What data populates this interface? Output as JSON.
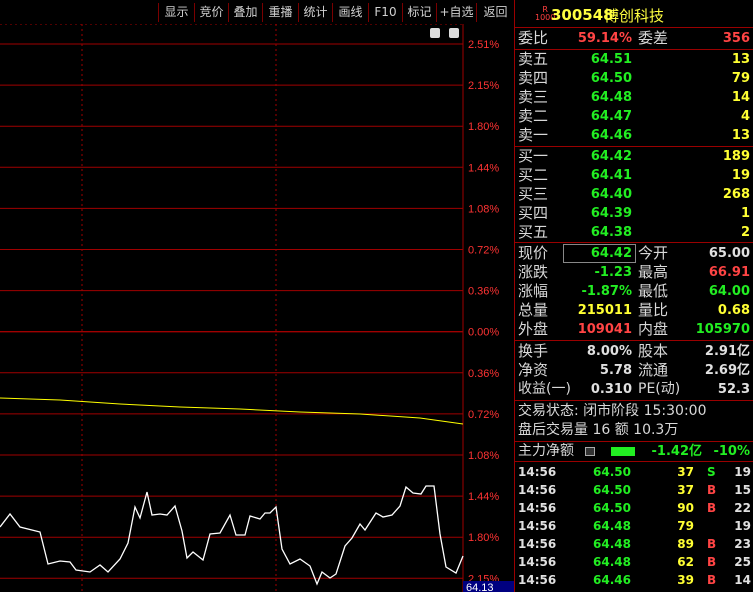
{
  "toolbar": {
    "buttons": [
      "显示",
      "竞价",
      "叠加",
      "重播",
      "统计",
      "画线",
      "F10",
      "标记",
      "+自选",
      "返回"
    ]
  },
  "chart_data": {
    "type": "line",
    "right_axis_labels": [
      "2.51%",
      "2.15%",
      "1.80%",
      "1.44%",
      "1.08%",
      "0.72%",
      "0.36%",
      "0.00%",
      "0.36%",
      "0.72%",
      "1.08%",
      "1.44%",
      "1.80%",
      "2.15%"
    ],
    "current_price_tag": "64.13",
    "colors": {
      "grid": "#a00000",
      "price_line": "#ffffff",
      "avg_line": "#ffff00",
      "label": "#ff3333",
      "tag_bg": "#000080"
    }
  },
  "stock": {
    "r_badge": "R",
    "r_sub": "1000",
    "code": "300548",
    "name": "博创科技"
  },
  "bid_ratio": {
    "label": "委比",
    "value": "59.14%",
    "diff_label": "委差",
    "diff_value": "356"
  },
  "sells": [
    {
      "label": "卖五",
      "price": "64.51",
      "volume": "13"
    },
    {
      "label": "卖四",
      "price": "64.50",
      "volume": "79"
    },
    {
      "label": "卖三",
      "price": "64.48",
      "volume": "14"
    },
    {
      "label": "卖二",
      "price": "64.47",
      "volume": "4"
    },
    {
      "label": "卖一",
      "price": "64.46",
      "volume": "13"
    }
  ],
  "buys": [
    {
      "label": "买一",
      "price": "64.42",
      "volume": "189"
    },
    {
      "label": "买二",
      "price": "64.41",
      "volume": "19"
    },
    {
      "label": "买三",
      "price": "64.40",
      "volume": "268"
    },
    {
      "label": "买四",
      "price": "64.39",
      "volume": "1"
    },
    {
      "label": "买五",
      "price": "64.38",
      "volume": "2"
    }
  ],
  "stats": {
    "now_label": "现价",
    "now": "64.42",
    "open_label": "今开",
    "open": "65.00",
    "chg_label": "涨跌",
    "chg": "-1.23",
    "high_label": "最高",
    "high": "66.91",
    "pct_label": "涨幅",
    "pct": "-1.87%",
    "low_label": "最低",
    "low": "64.00",
    "vol_label": "总量",
    "vol": "215011",
    "vr_label": "量比",
    "vr": "0.68",
    "out_label": "外盘",
    "out": "109041",
    "in_label": "内盘",
    "in": "105970"
  },
  "fund": {
    "turnover_label": "换手",
    "turnover": "8.00%",
    "equity_label": "股本",
    "equity": "2.91亿",
    "netasset_label": "净资",
    "netasset": "5.78",
    "float_label": "流通",
    "float": "2.69亿",
    "eps_label": "收益(一)",
    "eps": "0.310",
    "pe_label": "PE(动)",
    "pe": "52.3"
  },
  "status": {
    "line1": "交易状态: 闭市阶段 15:30:00",
    "line2": "盘后交易量 16 额 10.3万"
  },
  "mainflow": {
    "label": "主力净额",
    "value": "-1.42亿",
    "pct": "-10%"
  },
  "ticks": [
    {
      "time": "14:56",
      "price": "64.50",
      "vol": "37",
      "side": "S",
      "n": "19"
    },
    {
      "time": "14:56",
      "price": "64.50",
      "vol": "37",
      "side": "B",
      "n": "15"
    },
    {
      "time": "14:56",
      "price": "64.50",
      "vol": "90",
      "side": "B",
      "n": "22"
    },
    {
      "time": "14:56",
      "price": "64.48",
      "vol": "79",
      "side": "",
      "n": "19"
    },
    {
      "time": "14:56",
      "price": "64.48",
      "vol": "89",
      "side": "B",
      "n": "23"
    },
    {
      "time": "14:56",
      "price": "64.48",
      "vol": "62",
      "side": "B",
      "n": "25"
    },
    {
      "time": "14:56",
      "price": "64.46",
      "vol": "39",
      "side": "B",
      "n": "14"
    }
  ]
}
